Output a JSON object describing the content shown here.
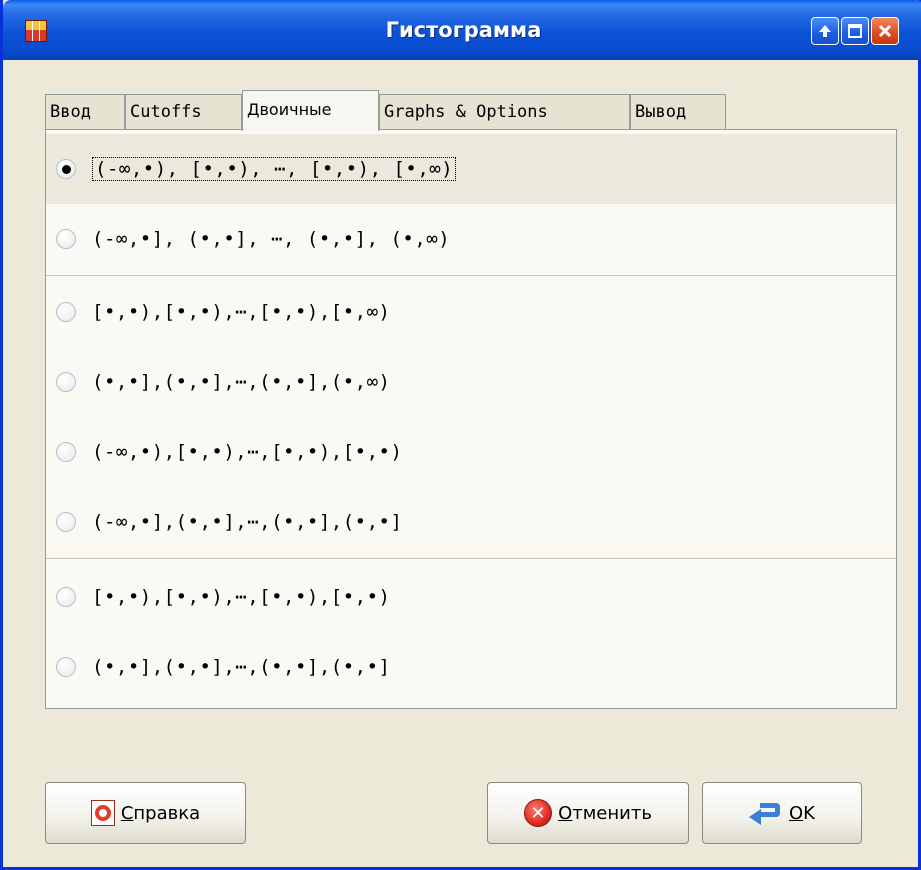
{
  "window": {
    "title": "Гистограмма"
  },
  "tabs": [
    {
      "label": "Ввод"
    },
    {
      "label": "Cutoffs"
    },
    {
      "label": "Двоичные"
    },
    {
      "label": "Graphs & Options"
    },
    {
      "label": "Вывод"
    }
  ],
  "active_tab": "Двоичные",
  "options": {
    "groups": [
      [
        {
          "label": "(-∞,•), [•,•), ⋯, [•,•), [•,∞)",
          "selected": true
        },
        {
          "label": "(-∞,•], (•,•], ⋯, (•,•], (•,∞)",
          "selected": false
        }
      ],
      [
        {
          "label": "[•,•),[•,•),⋯,[•,•),[•,∞)",
          "selected": false
        },
        {
          "label": "(•,•],(•,•],⋯,(•,•],(•,∞)",
          "selected": false
        },
        {
          "label": "(-∞,•),[•,•),⋯,[•,•),[•,•)",
          "selected": false
        },
        {
          "label": "(-∞,•],(•,•],⋯,(•,•],(•,•]",
          "selected": false
        }
      ],
      [
        {
          "label": "[•,•),[•,•),⋯,[•,•),[•,•)",
          "selected": false
        },
        {
          "label": "(•,•],(•,•],⋯,(•,•],(•,•]",
          "selected": false
        }
      ]
    ]
  },
  "buttons": {
    "help": {
      "first": "С",
      "rest": "правка",
      "icon": "help-lifebuoy-icon"
    },
    "cancel": {
      "first": "О",
      "rest": "тменить",
      "icon": "cancel-x-icon"
    },
    "ok": {
      "first": "O",
      "rest": "K",
      "icon": "ok-return-arrow-icon"
    }
  }
}
